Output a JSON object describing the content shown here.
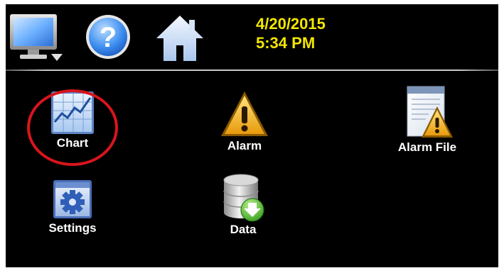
{
  "header": {
    "date": "4/20/2015",
    "time": "5:34 PM"
  },
  "toolbar": {
    "monitor_icon": "monitor-icon",
    "help_icon": "help-icon",
    "home_icon": "home-icon"
  },
  "apps": [
    {
      "label": "Chart",
      "icon": "chart-icon"
    },
    {
      "label": "Alarm",
      "icon": "alarm-icon"
    },
    {
      "label": "Alarm File",
      "icon": "alarm-file-icon"
    },
    {
      "label": "Settings",
      "icon": "settings-icon"
    },
    {
      "label": "Data",
      "icon": "data-icon"
    }
  ],
  "colors": {
    "datetime": "#f2e600",
    "highlight_ring": "#d8151c",
    "background": "#000000"
  }
}
